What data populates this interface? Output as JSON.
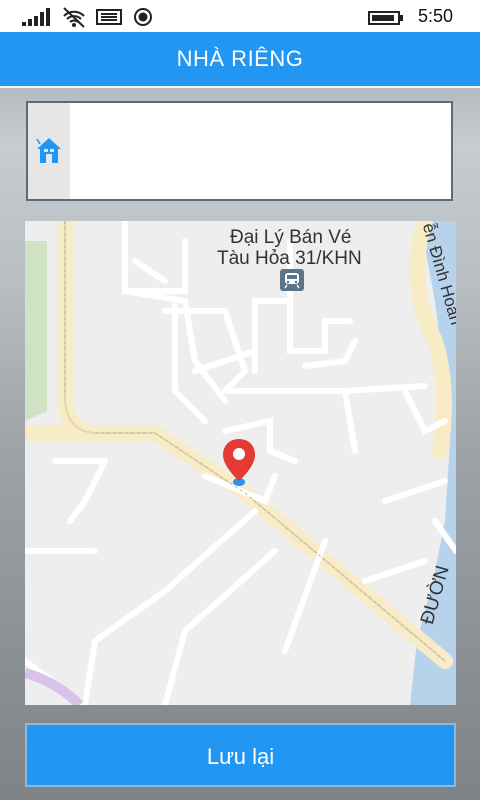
{
  "status_bar": {
    "time": "5:50",
    "icons": [
      "signal-icon",
      "wifi-icon",
      "message-icon",
      "record-icon",
      "battery-icon"
    ]
  },
  "header": {
    "title": "NHÀ RIÊNG"
  },
  "address": {
    "value": "",
    "icon": "home-icon"
  },
  "map": {
    "poi_line1": "Đại Lý Bán Vé",
    "poi_line2": "Tàu Hỏa 31/KHN",
    "poi_icon": "train-station-icon",
    "street_right": "ễn Đình Hoàn",
    "street_bottom": "ĐƯỜN",
    "marker_icon": "location-pin-icon"
  },
  "save_button": {
    "label": "Lưu lại"
  },
  "colors": {
    "primary": "#2196F3",
    "pin": "#e53935"
  }
}
